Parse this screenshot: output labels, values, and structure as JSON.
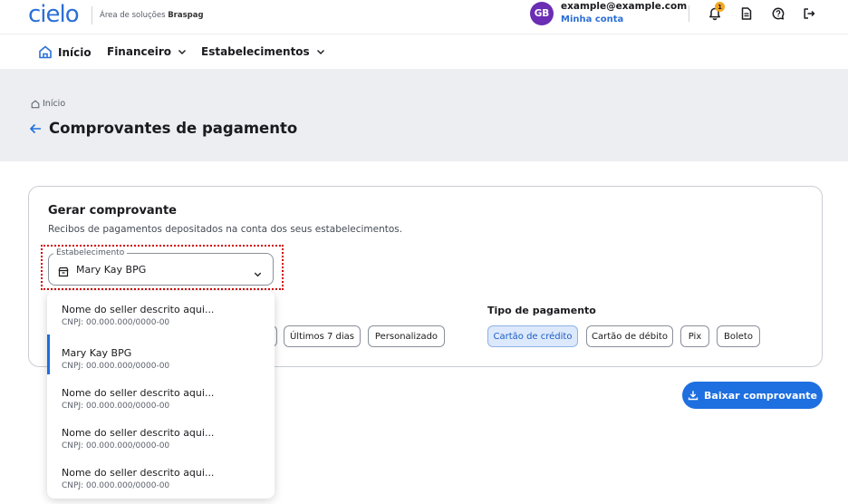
{
  "header": {
    "logo": "cielo",
    "subtitle_prefix": "Área de soluções",
    "subtitle_brand": "Braspag",
    "avatar_initials": "GB",
    "user_email": "example@example.com",
    "account_link": "Minha conta",
    "notification_count": "1",
    "icons": [
      "bell-icon",
      "document-icon",
      "chat-icon",
      "logout-icon"
    ]
  },
  "nav": {
    "items": [
      {
        "label": "Início",
        "icon": "home-icon"
      },
      {
        "label": "Financeiro",
        "icon": "chevron-down-icon"
      },
      {
        "label": "Estabelecimentos",
        "icon": "chevron-down-icon"
      }
    ]
  },
  "page": {
    "breadcrumb": "Início",
    "title": "Comprovantes de pagamento"
  },
  "card": {
    "title": "Gerar comprovante",
    "description": "Recibos de pagamentos depositados na conta dos seus estabelecimentos.",
    "establishment_label": "Estabelecimento",
    "establishment_value": "Mary Kay BPG",
    "period_options": [
      "Últimos 7 dias",
      "Personalizado"
    ],
    "payment_type_label": "Tipo de pagamento",
    "payment_types": [
      "Cartão de crédito",
      "Cartão de débito",
      "Pix",
      "Boleto"
    ],
    "selected_payment_type": "Cartão de crédito"
  },
  "download_button": "Baixar comprovante",
  "dropdown": {
    "options": [
      {
        "name": "Nome do seller descrito aqui...",
        "cnpj": "CNPJ: 00.000.000/0000-00"
      },
      {
        "name": "Mary Kay BPG",
        "cnpj": "CNPJ: 00.000.000/0000-00",
        "selected": true
      },
      {
        "name": "Nome do seller descrito aqui...",
        "cnpj": "CNPJ: 00.000.000/0000-00"
      },
      {
        "name": "Nome do seller descrito aqui...",
        "cnpj": "CNPJ: 00.000.000/0000-00"
      },
      {
        "name": "Nome do seller descrito aqui...",
        "cnpj": "CNPJ: 00.000.000/0000-00"
      }
    ]
  },
  "colors": {
    "brand": "#2b6fd6",
    "primary_button": "#1e6fe0",
    "avatar": "#6a2db3",
    "badge": "#f5a623",
    "focus_ring": "#d00000",
    "page_header_bg": "#eceef1"
  }
}
